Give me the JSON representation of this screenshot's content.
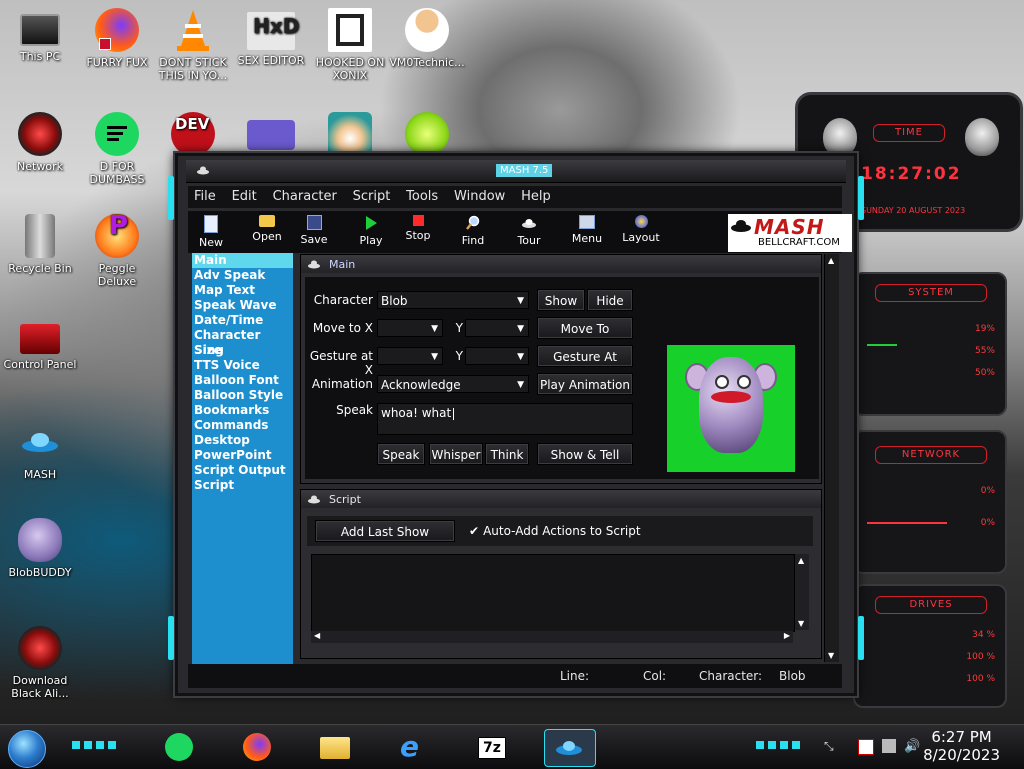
{
  "desktop": {
    "icons": [
      {
        "label": "This PC"
      },
      {
        "label": "FURRY FUX"
      },
      {
        "label": "DONT STICK THIS IN YO..."
      },
      {
        "label": "SEX EDITOR"
      },
      {
        "label": "HOOKED ON XONIX"
      },
      {
        "label": "VM0Technic..."
      },
      {
        "label": "Network"
      },
      {
        "label": "D FOR DUMBASS"
      },
      {
        "label": "DEV"
      },
      {
        "label": "Recycle Bin"
      },
      {
        "label": "Peggle Deluxe"
      },
      {
        "label": "Control Panel"
      },
      {
        "label": "MASH"
      },
      {
        "label": "BlobBUDDY"
      },
      {
        "label": "Download Black Ali..."
      }
    ]
  },
  "window": {
    "title": "MASH 7.5",
    "menu": [
      "File",
      "Edit",
      "Character",
      "Script",
      "Tools",
      "Window",
      "Help"
    ],
    "toolbar": [
      "New",
      "Open",
      "Save",
      "Play",
      "Stop",
      "Find",
      "Tour",
      "Menu",
      "Layout"
    ],
    "brand": {
      "logo": "MASH",
      "url": "BELLCRAFT.COM"
    },
    "nav": [
      "Main",
      "Adv Speak",
      "Map Text",
      "Speak Wave",
      "Date/Time",
      "Character Size",
      "Sing",
      "TTS Voice",
      "Balloon Font",
      "Balloon Style",
      "Bookmarks",
      "Commands",
      "Desktop",
      "PowerPoint",
      "Script Output",
      "Script"
    ],
    "nav_selected": "Main",
    "main_panel": {
      "title": "Main",
      "character_label": "Character",
      "character_value": "Blob",
      "show_button": "Show",
      "hide_button": "Hide",
      "move_to_x_label": "Move to X",
      "y_label": "Y",
      "move_to_button": "Move To",
      "gesture_at_x_label": "Gesture at X",
      "gesture_at_button": "Gesture At",
      "animation_label": "Animation",
      "animation_value": "Acknowledge",
      "play_animation_button": "Play Animation",
      "speak_label": "Speak",
      "speak_value": "whoa! what",
      "speak_button": "Speak",
      "whisper_button": "Whisper",
      "think_button": "Think",
      "show_tell_button": "Show & Tell"
    },
    "script_panel": {
      "title": "Script",
      "add_last_show_button": "Add Last Show",
      "auto_add_label": "Auto-Add Actions to Script",
      "auto_add_checked": true
    },
    "status": {
      "line_label": "Line:",
      "col_label": "Col:",
      "character_label": "Character:",
      "character_value": "Blob"
    }
  },
  "gadget": {
    "time_title": "TIME",
    "time_value": "18:27:02",
    "date_value": "SUNDAY 20 AUGUST 2023",
    "system_title": "SYSTEM",
    "system_values": [
      "19%",
      "55%",
      "50%"
    ],
    "network_title": "NETWORK",
    "network_values": [
      "0%",
      "0%"
    ],
    "drives_title": "DRIVES",
    "drives_values": [
      "34 %",
      "100 %",
      "100 %"
    ]
  },
  "taskbar": {
    "time": "6:27 PM",
    "date": "8/20/2023"
  },
  "colors": {
    "nav_bg": "#1e8fce",
    "nav_selected": "#5fd8ee",
    "accent_cyan": "#29e0f0",
    "character_bg": "#17d12a",
    "gadget_red": "#ff3340"
  }
}
